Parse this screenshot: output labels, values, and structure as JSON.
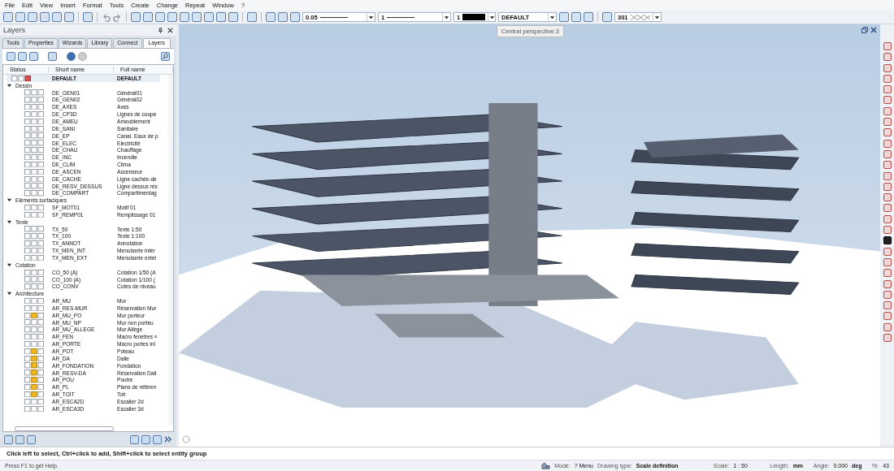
{
  "menu": [
    "File",
    "Edit",
    "View",
    "Insert",
    "Format",
    "Tools",
    "Create",
    "Change",
    "Repeat",
    "Window",
    "?"
  ],
  "toolbar": {
    "pen_thickness": "0.05",
    "line_type": "1",
    "color_number": "1",
    "layer": "DEFAULT",
    "pattern": "301"
  },
  "panel": {
    "title": "Layers",
    "tabs": [
      {
        "label": "Tools",
        "selected": false
      },
      {
        "label": "Properties",
        "selected": false
      },
      {
        "label": "Wizards",
        "selected": false
      },
      {
        "label": "Library",
        "selected": false
      },
      {
        "label": "Connect",
        "selected": false
      },
      {
        "label": "Layers",
        "selected": true
      }
    ],
    "columns": [
      "Status",
      "Short name",
      "Full name"
    ],
    "current_layer": {
      "short": "DEFAULT",
      "full": "DEFAULT"
    },
    "groups": [
      {
        "name": "Dessin",
        "expanded": true,
        "children": [
          {
            "short": "DE_GEN01",
            "full": "Général01",
            "active": false
          },
          {
            "short": "DE_GEN02",
            "full": "Général02",
            "active": false
          },
          {
            "short": "DE_AXES",
            "full": "Axes",
            "active": false
          },
          {
            "short": "DE_CP3D",
            "full": "Lignes de coupe",
            "active": false
          },
          {
            "short": "DE_AMEU",
            "full": "Ameublement",
            "active": false
          },
          {
            "short": "DE_SANI",
            "full": "Sanitaire",
            "active": false
          },
          {
            "short": "DE_EP",
            "full": "Canal. Eaux de p",
            "active": false
          },
          {
            "short": "DE_ELEC",
            "full": "Electricité",
            "active": false
          },
          {
            "short": "DE_CHAU",
            "full": "Chauffage",
            "active": false
          },
          {
            "short": "DE_INC",
            "full": "Incendie",
            "active": false
          },
          {
            "short": "DE_CLIM",
            "full": "Clima",
            "active": false
          },
          {
            "short": "DE_ASCEN",
            "full": "Ascenseur",
            "active": false
          },
          {
            "short": "DE_CACHE",
            "full": "Ligne cachée-de",
            "active": false
          },
          {
            "short": "DE_RESV_DESSUS",
            "full": "Ligne dessus rés",
            "active": false
          },
          {
            "short": "DE_COMPART",
            "full": "Compartimentag",
            "active": false
          }
        ]
      },
      {
        "name": "Eléments surfaciques",
        "expanded": true,
        "children": [
          {
            "short": "SF_MOT01",
            "full": "Motif 01",
            "active": false
          },
          {
            "short": "SF_REMP01",
            "full": "Remplissage 01",
            "active": false
          }
        ]
      },
      {
        "name": "Texte",
        "expanded": true,
        "children": [
          {
            "short": "TX_50",
            "full": "Texte 1:50",
            "active": false
          },
          {
            "short": "TX_100",
            "full": "Texte 1:100",
            "active": false
          },
          {
            "short": "TX_ANNOT",
            "full": "Annotation",
            "active": false
          },
          {
            "short": "TX_MEN_INT",
            "full": "Menuiserie intér",
            "active": false
          },
          {
            "short": "TX_MEN_EXT",
            "full": "Menuiserie extéi",
            "active": false
          }
        ]
      },
      {
        "name": "Cotation",
        "expanded": true,
        "children": [
          {
            "short": "CO_50 (A)",
            "full": "Cotation 1/50 (A",
            "active": false
          },
          {
            "short": "CO_100 (A)",
            "full": "Cotation 1/100 (",
            "active": false
          },
          {
            "short": "CO_CONV",
            "full": "Cotes de niveau",
            "active": false
          }
        ]
      },
      {
        "name": "Architecture",
        "expanded": true,
        "children": [
          {
            "short": "AR_MU",
            "full": "Mur",
            "active": false
          },
          {
            "short": "AR_RES-MUR",
            "full": "Réservation Mur",
            "active": false
          },
          {
            "short": "AR_MU_PO",
            "full": "Mur porteur",
            "active": true
          },
          {
            "short": "AR_MU_NP",
            "full": "Mur non porteu",
            "active": false
          },
          {
            "short": "AR_MU_ALLEGE",
            "full": "Mur Allège",
            "active": false
          },
          {
            "short": "AR_FEN",
            "full": "Macro fenetres «",
            "active": false
          },
          {
            "short": "AR_PORTE",
            "full": "Macro portes inl",
            "active": false
          },
          {
            "short": "AR_POT",
            "full": "Poteau",
            "active": true
          },
          {
            "short": "AR_DA",
            "full": "Dalle",
            "active": true
          },
          {
            "short": "AR_FONDATION",
            "full": "Fondation",
            "active": true
          },
          {
            "short": "AR_RESV-DA",
            "full": "Réservation Dall",
            "active": true
          },
          {
            "short": "AR_POU",
            "full": "Poutre",
            "active": true
          },
          {
            "short": "AR_PL",
            "full": "Plans de référen",
            "active": true
          },
          {
            "short": "AR_TOIT",
            "full": "Toit",
            "active": true
          },
          {
            "short": "AR_ESCA2D",
            "full": "Escalier 2d",
            "active": false
          },
          {
            "short": "AR_ESCA3D",
            "full": "Escalier 3d",
            "active": false
          }
        ]
      }
    ]
  },
  "viewport": {
    "tooltip": "Central perspective:3"
  },
  "prompt": "Click left to select, Ctrl+click to add, Shift+click to select entity group",
  "status_bar": {
    "help": "Press F1 to get Help.",
    "mode_label": "Mode:",
    "mode": "? Menu",
    "drawing_type_label": "Drawing type:",
    "drawing_type": "Scale definition",
    "scale_label": "Scale:",
    "scale": "1 : 50",
    "length_label": "Length:",
    "length": "mm",
    "angle_label": "Angle:",
    "angle": "0.000",
    "angle_unit": "deg",
    "zoom_label": "%:",
    "zoom": "43"
  }
}
